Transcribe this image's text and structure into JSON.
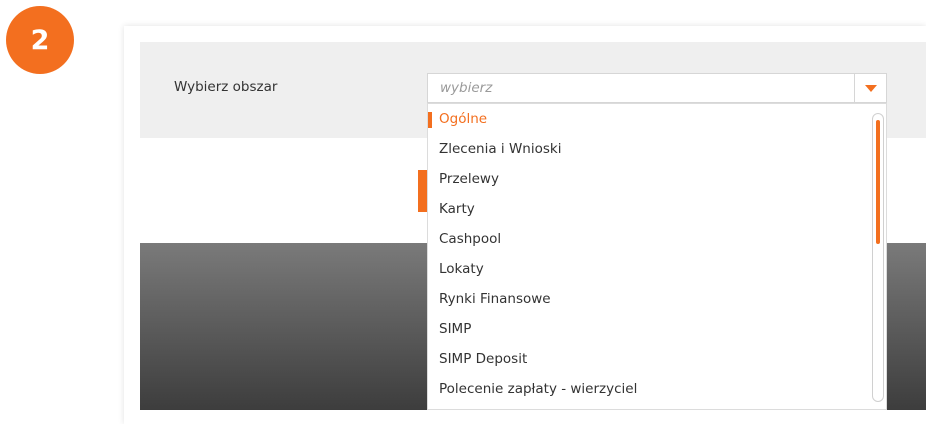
{
  "step": {
    "number": "2"
  },
  "form": {
    "label": "Wybierz obszar",
    "select_placeholder": "wybierz"
  },
  "dropdown": {
    "options": [
      "Ogólne",
      "Zlecenia i Wnioski",
      "Przelewy",
      "Karty",
      "Cashpool",
      "Lokaty",
      "Rynki Finansowe",
      "SIMP",
      "SIMP Deposit",
      "Polecenie zapłaty - wierzyciel"
    ],
    "selected": "Ogólne"
  },
  "colors": {
    "accent": "#f36f1f",
    "band": "#efefef"
  },
  "icons": {
    "toggle": "chevron-down-icon"
  }
}
